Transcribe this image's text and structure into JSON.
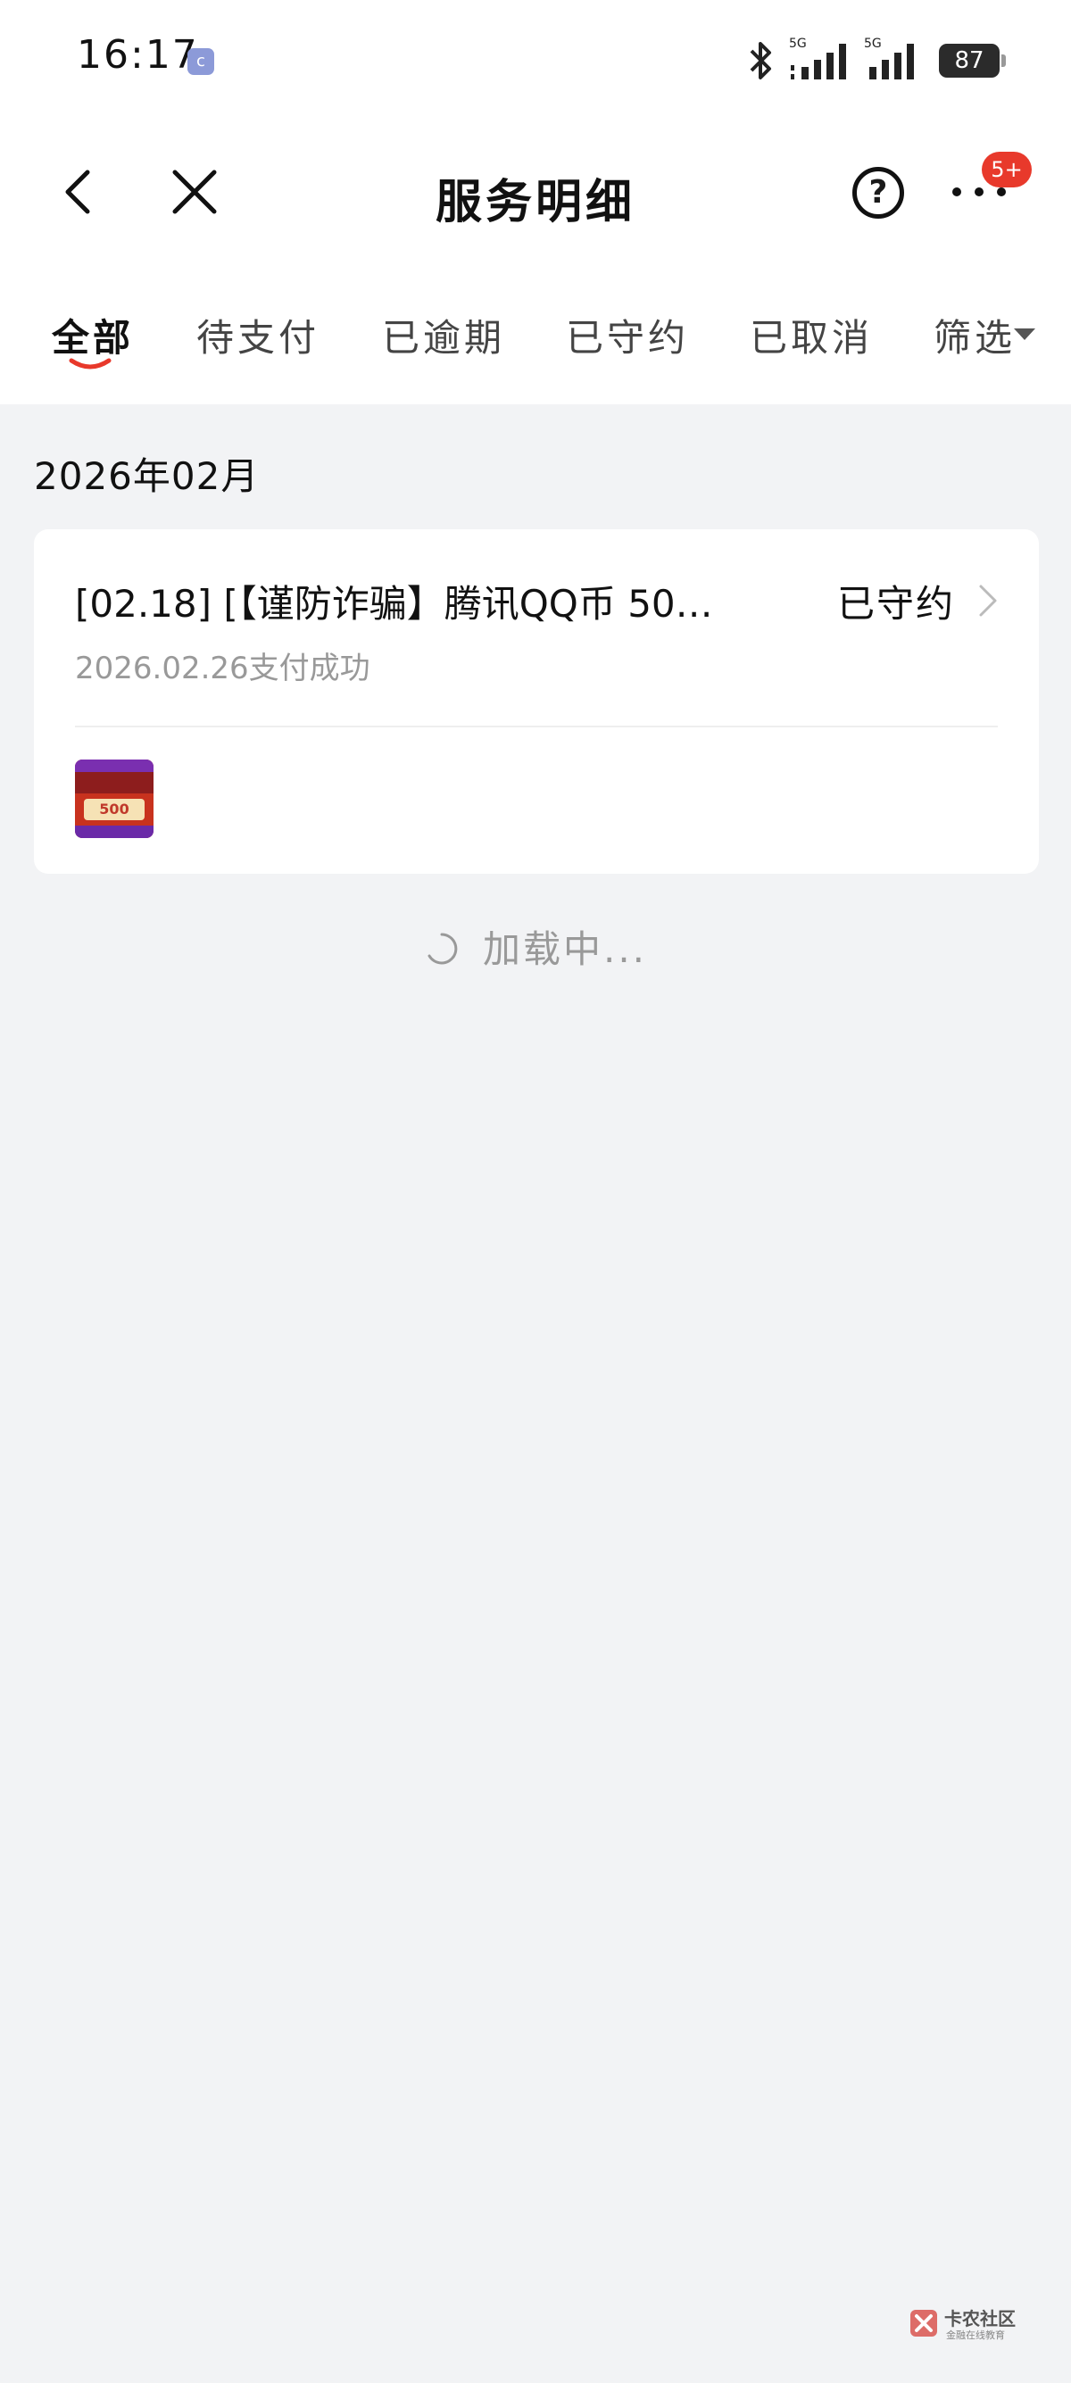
{
  "status_bar": {
    "time": "16:17",
    "notification_icon": "c",
    "network_1": "5G",
    "network_2": "5G",
    "battery": "87"
  },
  "nav": {
    "title": "服务明细",
    "help_label": "?",
    "badge": "5+"
  },
  "tabs": [
    {
      "label": "全部",
      "active": true
    },
    {
      "label": "待支付",
      "active": false
    },
    {
      "label": "已逾期",
      "active": false
    },
    {
      "label": "已守约",
      "active": false
    },
    {
      "label": "已取消",
      "active": false
    },
    {
      "label": "筛选",
      "active": false
    }
  ],
  "content": {
    "month": "2026年02月",
    "card": {
      "title": "[02.18] [【谨防诈骗】腾讯QQ币 50…",
      "status": "已守约",
      "subtitle": "2026.02.26支付成功",
      "thumb_amount": "500"
    },
    "loading": "加载中..."
  },
  "watermark": {
    "title": "卡农社区",
    "subtitle": "金融在线教育"
  },
  "colors": {
    "accent": "#e8392b",
    "background": "#f2f3f5",
    "muted_text": "#999999"
  }
}
